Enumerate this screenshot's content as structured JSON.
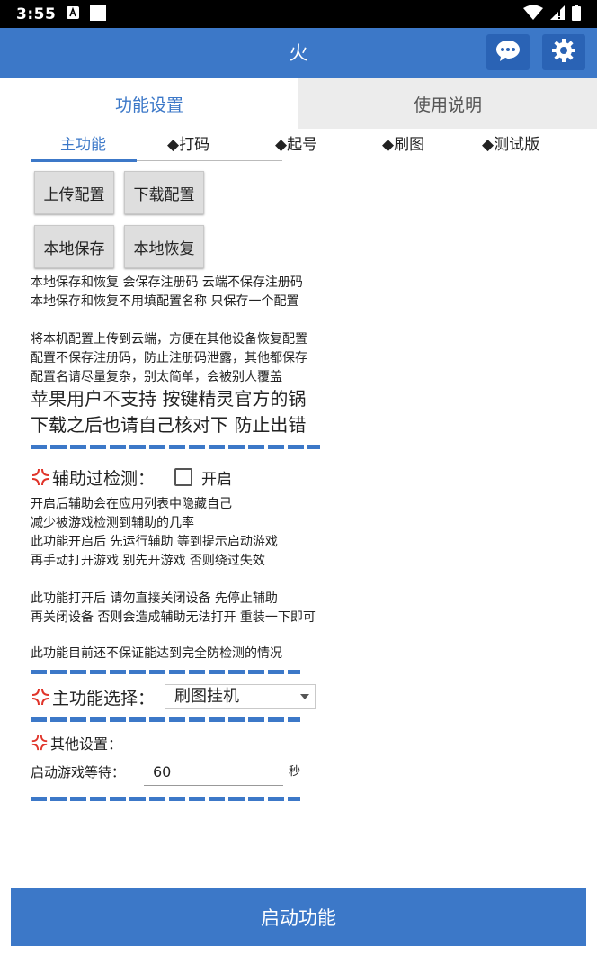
{
  "status_bar": {
    "time": "3:55",
    "icons": [
      "notification-a-icon",
      "square-icon",
      "wifi-icon",
      "signal-icon",
      "battery-icon"
    ]
  },
  "app_bar": {
    "title": "火",
    "buttons": [
      "chat-icon",
      "gear-icon"
    ]
  },
  "tabs": [
    {
      "label": "功能设置",
      "active": true
    },
    {
      "label": "使用说明",
      "active": false
    }
  ],
  "sub_tabs": [
    {
      "label": "主功能",
      "active": true
    },
    {
      "label": "◆打码"
    },
    {
      "label": "◆起号"
    },
    {
      "label": "◆刷图"
    },
    {
      "label": "◆测试版"
    }
  ],
  "config_buttons": {
    "upload": "上传配置",
    "download": "下载配置",
    "local_save": "本地保存",
    "local_restore": "本地恢复"
  },
  "notes": {
    "local_1": "本地保存和恢复 会保存注册码 云端不保存注册码",
    "local_2": "本地保存和恢复不用填配置名称 只保存一个配置",
    "cloud_1": "将本机配置上传到云端，方便在其他设备恢复配置",
    "cloud_2": "配置不保存注册码，防止注册码泄露，其他都保存",
    "cloud_3": "配置名请尽量复杂，别太简单，会被别人覆盖",
    "warn_1": "苹果用户不支持 按键精灵官方的锅",
    "warn_2": "下载之后也请自己核对下 防止出错"
  },
  "bypass": {
    "label": "辅助过检测：",
    "checkbox_label": "开启",
    "checked": false,
    "desc_1": "开启后辅助会在应用列表中隐藏自己",
    "desc_2": "减少被游戏检测到辅助的几率",
    "desc_3": "此功能开启后 先运行辅助 等到提示启动游戏",
    "desc_4": "再手动打开游戏 别先开游戏 否则绕过失效",
    "desc_5": "此功能打开后 请勿直接关闭设备 先停止辅助",
    "desc_6": "再关闭设备 否则会造成辅助无法打开 重装一下即可",
    "desc_7": "此功能目前还不保证能达到完全防检测的情况"
  },
  "main_function": {
    "label": "主功能选择：",
    "selected": "刷图挂机"
  },
  "other_settings": {
    "label": "其他设置：",
    "wait_label": "启动游戏等待：",
    "wait_value": "60",
    "wait_unit": "秒"
  },
  "start_button": "启动功能",
  "colors": {
    "accent": "#3c78c8",
    "accent_dark": "#2a63b5",
    "boom_red": "#e0342a"
  }
}
